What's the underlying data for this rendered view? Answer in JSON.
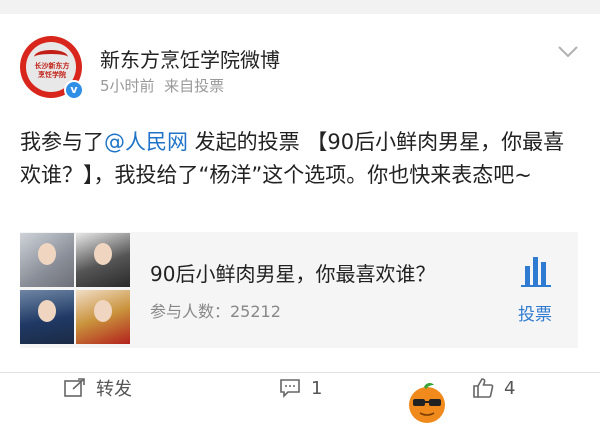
{
  "post": {
    "account_name": "新东方烹饪学院微博",
    "time": "5小时前",
    "source": "来自投票",
    "avatar_logo_text": "长沙新东方 烹饪学院",
    "text_prefix": "我参与了",
    "mention": "@人民网",
    "text_rest": " 发起的投票 【90后小鲜肉男星，你最喜欢谁？】，我投给了“杨洋”这个选项。你也快来表态吧~"
  },
  "vote_card": {
    "title": "90后小鲜肉男星，你最喜欢谁？",
    "participants": "参与人数：25212",
    "vote_label": "投票"
  },
  "actions": {
    "repost_label": "转发",
    "comment_count": "1",
    "like_count": "4"
  },
  "colors": {
    "accent_blue": "#2f7bd1",
    "mention_blue": "#1f74c9",
    "brand_red": "#d9261c"
  },
  "icons": [
    "chevron-down-icon",
    "verified-icon",
    "bar-chart-icon",
    "repost-icon",
    "comment-icon",
    "like-icon",
    "watermark-orange-icon"
  ]
}
